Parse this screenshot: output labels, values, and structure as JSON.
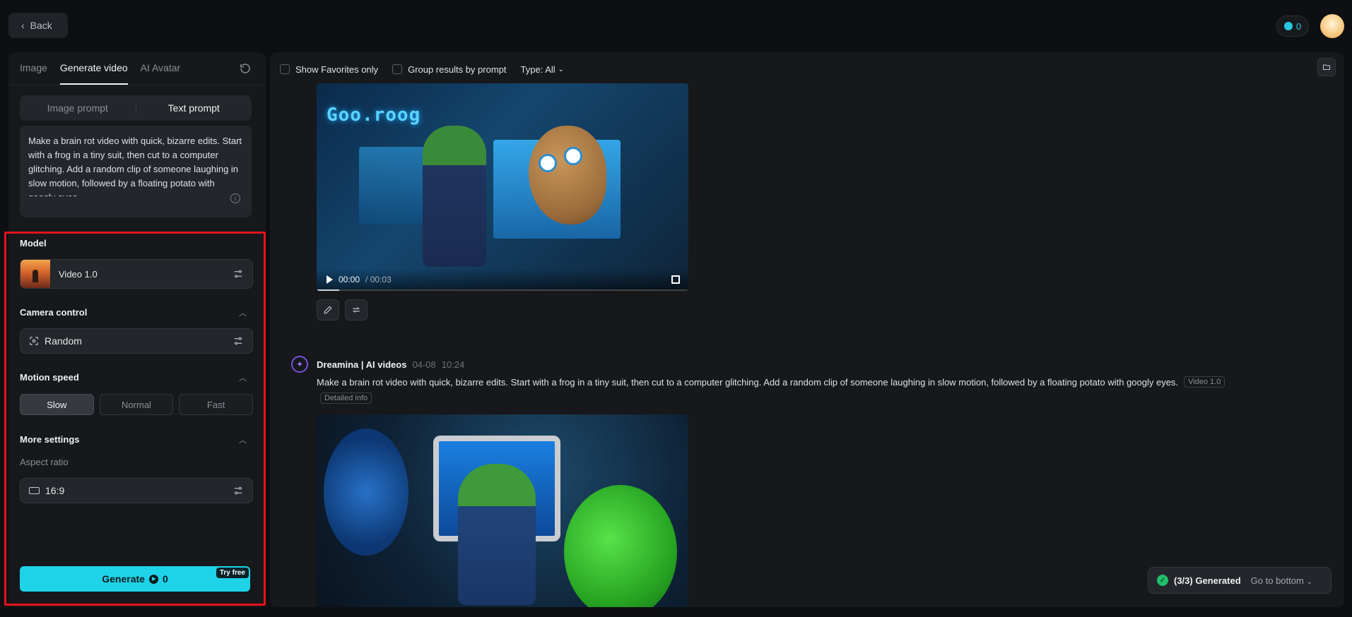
{
  "topbar": {
    "back_label": "Back",
    "credits": "0"
  },
  "sidebar": {
    "tabs": [
      {
        "label": "Image"
      },
      {
        "label": "Generate video"
      },
      {
        "label": "AI Avatar"
      }
    ],
    "prompt_modes": [
      "Image prompt",
      "Text prompt"
    ],
    "prompt_text": "Make a brain rot video with quick, bizarre edits. Start with a frog in a tiny suit, then cut to a computer glitching. Add a random clip of someone laughing in slow motion, followed by a floating potato with googly eyes.",
    "model": {
      "label": "Model",
      "name": "Video 1.0"
    },
    "camera": {
      "label": "Camera control",
      "value": "Random"
    },
    "motion": {
      "label": "Motion speed",
      "options": [
        "Slow",
        "Normal",
        "Fast"
      ],
      "selected": "Slow"
    },
    "more": {
      "label": "More settings",
      "aspect_label": "Aspect ratio",
      "aspect_value": "16:9"
    },
    "generate": {
      "label": "Generate",
      "cost": "0",
      "badge": "Try free"
    }
  },
  "main": {
    "filters": {
      "favorites": "Show Favorites only",
      "group": "Group results by prompt",
      "type": "Type: All"
    },
    "video1": {
      "time_current": "00:00",
      "time_total": "/ 00:03",
      "progress": 0.06
    },
    "entry": {
      "author": "Dreamina | AI videos",
      "date": "04-08",
      "time": "10:24",
      "prompt": "Make a brain rot video with quick, bizarre edits. Start with a frog in a tiny suit, then cut to a computer glitching. Add a random clip of someone laughing in slow motion, followed by a floating potato with googly eyes.",
      "model_tag": "Video 1.0",
      "detail_tag": "Detailed info"
    },
    "toast": {
      "status": "(3/3) Generated",
      "link": "Go to bottom"
    }
  },
  "colors": {
    "accent": "#1ed3e8",
    "highlight": "#e8121c",
    "success": "#1fbf6b"
  }
}
